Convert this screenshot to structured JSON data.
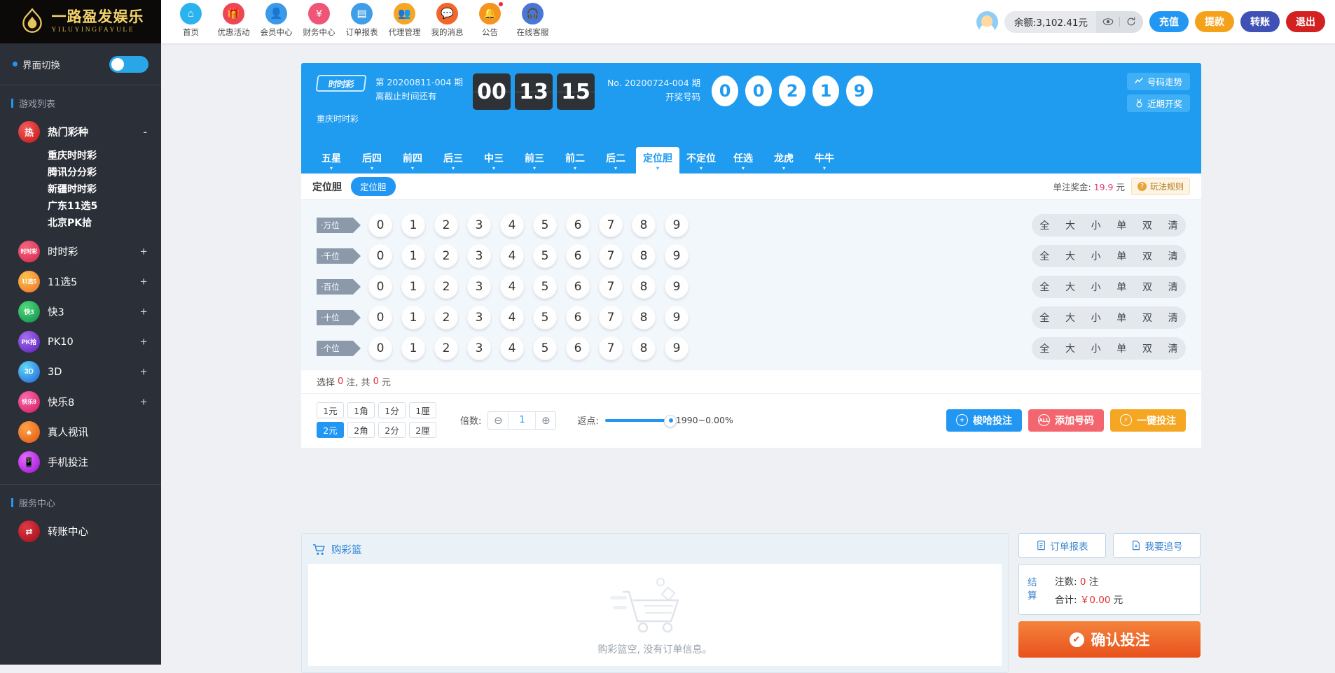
{
  "brand": {
    "cn": "一路盈发娱乐",
    "en": "YILUYINGFAYULE",
    "icon": "flame-logo"
  },
  "nav": [
    {
      "label": "首页",
      "icon": "home-icon",
      "color": "#2bb3f0",
      "glyph": "⌂",
      "active": true,
      "dot": false
    },
    {
      "label": "优惠活动",
      "icon": "gift-icon",
      "color": "#ef4655",
      "glyph": "Ἰ1",
      "active": false,
      "dot": false
    },
    {
      "label": "会员中心",
      "icon": "user-icon",
      "color": "#3b9ae8",
      "glyph": "♟",
      "active": false,
      "dot": false
    },
    {
      "label": "财务中心",
      "icon": "money-bag-icon",
      "color": "#ee5577",
      "glyph": "¥",
      "active": false,
      "dot": false
    },
    {
      "label": "订单报表",
      "icon": "report-icon",
      "color": "#3f9ee8",
      "glyph": "☰",
      "active": false,
      "dot": false
    },
    {
      "label": "代理管理",
      "icon": "agent-icon",
      "color": "#f5a623",
      "glyph": "⛭",
      "active": false,
      "dot": false
    },
    {
      "label": "我的消息",
      "icon": "message-icon",
      "color": "#f2662c",
      "glyph": "●",
      "active": false,
      "dot": false
    },
    {
      "label": "公告",
      "icon": "bell-icon",
      "color": "#f5941e",
      "glyph": "⌂",
      "active": false,
      "dot": true
    },
    {
      "label": "在线客服",
      "icon": "headset-icon",
      "color": "#4a76d8",
      "glyph": "♫",
      "active": false,
      "dot": false
    }
  ],
  "account": {
    "avatar": "user-avatar",
    "balance_label": "余额:3,102.41元",
    "eye_icon": "eye-icon",
    "refresh_icon": "refresh-icon",
    "buttons": [
      {
        "label": "充值",
        "name": "recharge-button",
        "class": "cz"
      },
      {
        "label": "提款",
        "name": "withdraw-button",
        "class": "tk"
      },
      {
        "label": "转账",
        "name": "transfer-button",
        "class": "zz"
      },
      {
        "label": "退出",
        "name": "logout-button",
        "class": "tc"
      }
    ]
  },
  "sidebar": {
    "interface_switch_label": "界面切换",
    "interface_switch_on": true,
    "game_list_title": "游戏列表",
    "service_title": "服务中心",
    "hot": {
      "label": "热门彩种",
      "collapse_sign": "-",
      "icon_color": "#d51e1e",
      "icon_text": "热",
      "children": [
        "重庆时时彩",
        "腾讯分分彩",
        "新疆时时彩",
        "广东11选5",
        "北京PK拾"
      ]
    },
    "groups": [
      {
        "label": "时时彩",
        "sign": "+",
        "icon_color": "#e8384f",
        "icon_text": "时时彩"
      },
      {
        "label": "11选5",
        "sign": "+",
        "icon_color": "#f3a33a",
        "icon_text": "11选5"
      },
      {
        "label": "快3",
        "sign": "+",
        "icon_color": "#17a85c",
        "icon_text": "快3"
      },
      {
        "label": "PK10",
        "sign": "+",
        "icon_color": "#7b3fd4",
        "icon_text": "PK拾"
      },
      {
        "label": "3D",
        "sign": "+",
        "icon_color": "#2f7fe8",
        "icon_text": "3D"
      },
      {
        "label": "快乐8",
        "sign": "+",
        "icon_color": "#e33a84",
        "icon_text": "快乐8"
      },
      {
        "label": "真人视讯",
        "sign": "",
        "icon_color": "#ef7a1e",
        "icon_text": "♠"
      },
      {
        "label": "手机投注",
        "sign": "",
        "icon_color": "#c724e8",
        "icon_text": "☎"
      }
    ],
    "services": [
      {
        "label": "转账中心",
        "icon_color": "#c0252c",
        "icon_text": "⇄"
      }
    ]
  },
  "lottery": {
    "logo_text": "时时彩",
    "game_name": "重庆时时彩",
    "issue_line1": "第 20200811-004 期",
    "issue_line2": "离截止时间还有",
    "countdown": [
      "00",
      "13",
      "15"
    ],
    "draw_line1": "No. 20200724-004 期",
    "draw_line2": "开奖号码",
    "draw_numbers": [
      "0",
      "0",
      "2",
      "1",
      "9"
    ],
    "head_buttons": [
      {
        "label": "号码走势",
        "icon": "trend-icon"
      },
      {
        "label": "近期开奖",
        "icon": "medal-icon"
      }
    ],
    "tabs": [
      {
        "label": "五星",
        "active": false
      },
      {
        "label": "后四",
        "active": false
      },
      {
        "label": "前四",
        "active": false
      },
      {
        "label": "后三",
        "active": false
      },
      {
        "label": "中三",
        "active": false
      },
      {
        "label": "前三",
        "active": false
      },
      {
        "label": "前二",
        "active": false
      },
      {
        "label": "后二",
        "active": false
      },
      {
        "label": "定位胆",
        "active": true
      },
      {
        "label": "不定位",
        "active": false
      },
      {
        "label": "任选",
        "active": false
      },
      {
        "label": "龙虎",
        "active": false
      },
      {
        "label": "牛牛",
        "active": false
      }
    ],
    "subplay_name": "定位胆",
    "subplay_chip": "定位胆",
    "prize_label": "单注奖金:",
    "prize_value": "19.9",
    "prize_unit": "元",
    "rule_label": "玩法规则"
  },
  "board": {
    "rows": [
      {
        "pos": "·万位",
        "numbers": [
          "0",
          "1",
          "2",
          "3",
          "4",
          "5",
          "6",
          "7",
          "8",
          "9"
        ]
      },
      {
        "pos": "·千位",
        "numbers": [
          "0",
          "1",
          "2",
          "3",
          "4",
          "5",
          "6",
          "7",
          "8",
          "9"
        ]
      },
      {
        "pos": "·百位",
        "numbers": [
          "0",
          "1",
          "2",
          "3",
          "4",
          "5",
          "6",
          "7",
          "8",
          "9"
        ]
      },
      {
        "pos": "·十位",
        "numbers": [
          "0",
          "1",
          "2",
          "3",
          "4",
          "5",
          "6",
          "7",
          "8",
          "9"
        ]
      },
      {
        "pos": "·个位",
        "numbers": [
          "0",
          "1",
          "2",
          "3",
          "4",
          "5",
          "6",
          "7",
          "8",
          "9"
        ]
      }
    ],
    "quick_select": [
      "全",
      "大",
      "小",
      "单",
      "双",
      "清"
    ]
  },
  "selection": {
    "prefix": "选择",
    "bets": "0",
    "mid": "注, 共",
    "amount": "0",
    "suffix": "元"
  },
  "controls": {
    "units": [
      {
        "label": "1元",
        "active": false
      },
      {
        "label": "1角",
        "active": false
      },
      {
        "label": "1分",
        "active": false
      },
      {
        "label": "1厘",
        "active": false
      },
      {
        "label": "2元",
        "active": true
      },
      {
        "label": "2角",
        "active": false
      },
      {
        "label": "2分",
        "active": false
      },
      {
        "label": "2厘",
        "active": false
      }
    ],
    "multiplier_label": "倍数:",
    "multiplier_value": "1",
    "minus_icon": "minus-circle-icon",
    "plus_icon": "plus-circle-icon",
    "rebate_label": "返点:",
    "rebate_value": "1990~0.00%",
    "actions": [
      {
        "label": "梭哈投注",
        "class": "blue",
        "icon": "+",
        "name": "all-in-bet-button"
      },
      {
        "label": "添加号码",
        "class": "red",
        "icon": "ALL",
        "name": "add-number-button"
      },
      {
        "label": "一键投注",
        "class": "orange",
        "icon": "⚡",
        "name": "one-click-bet-button"
      }
    ]
  },
  "cart": {
    "title": "购彩篮",
    "icon": "cart-icon",
    "empty_text": "购彩篮空, 没有订单信息。"
  },
  "summary": {
    "buttons": [
      {
        "label": "订单报表",
        "icon": "document-icon",
        "name": "order-report-button"
      },
      {
        "label": "我要追号",
        "icon": "file-plus-icon",
        "name": "chase-number-button"
      }
    ],
    "settle_label_1": "结",
    "settle_label_2": "算",
    "count_label": "注数:",
    "count_value": "0",
    "count_unit": "注",
    "total_label": "合计:",
    "total_value": "￥0.00",
    "total_unit": "元",
    "confirm_label": "确认投注",
    "confirm_icon": "check-icon"
  }
}
